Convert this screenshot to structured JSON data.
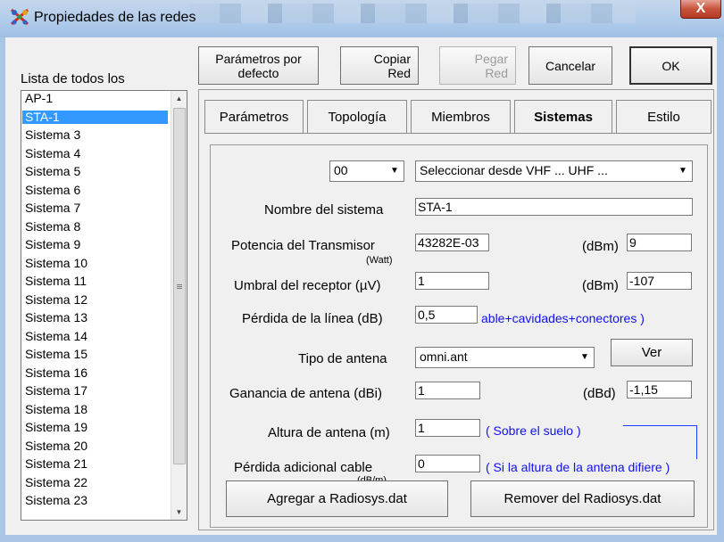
{
  "window": {
    "title": "Propiedades de las redes",
    "close_label": "X"
  },
  "list": {
    "label": "Lista de todos los",
    "items": [
      "AP-1",
      "STA-1",
      "Sistema  3",
      "Sistema  4",
      "Sistema  5",
      "Sistema  6",
      "Sistema  7",
      "Sistema  8",
      "Sistema  9",
      "Sistema  10",
      "Sistema  11",
      "Sistema  12",
      "Sistema  13",
      "Sistema  14",
      "Sistema  15",
      "Sistema  16",
      "Sistema  17",
      "Sistema  18",
      "Sistema  19",
      "Sistema  20",
      "Sistema  21",
      "Sistema  22",
      "Sistema  23"
    ],
    "selected_index": 1
  },
  "toolbar": {
    "defaults_line1": "Parámetros por",
    "defaults_line2": "defecto",
    "copy_line1": "Copiar",
    "copy_line2": "Red",
    "paste_line1": "Pegar",
    "paste_line2": "Red",
    "cancel": "Cancelar",
    "ok": "OK"
  },
  "tabs": [
    "Parámetros",
    "Topología",
    "Miembros",
    "Sistemas",
    "Estilo"
  ],
  "active_tab": "Sistemas",
  "form": {
    "system_number": "00",
    "system_select": "Seleccionar desde VHF ... UHF ...",
    "system_name_label": "Nombre del sistema",
    "system_name": "STA-1",
    "tx_power_label": "Potencia del Transmisor",
    "tx_power_unit_label": "(Watt)",
    "tx_power_watt": "43282E-03",
    "tx_power_dbm_label": "(dBm)",
    "tx_power_dbm": "9",
    "rx_threshold_label": "Umbral del receptor (µV)",
    "rx_threshold_uv": "1",
    "rx_threshold_dbm_label": "(dBm)",
    "rx_threshold_dbm": "-107",
    "line_loss_label": "Pérdida de la línea (dB)",
    "line_loss": "0,5",
    "line_loss_hint": "able+cavidades+conectores )",
    "antenna_type_label": "Tipo de antena",
    "antenna_type": "omni.ant",
    "view_button": "Ver",
    "antenna_gain_label": "Ganancia de antena (dBi)",
    "antenna_gain_dbi": "1",
    "antenna_gain_dbd_label": "(dBd)",
    "antenna_gain_dbd": "-1,15",
    "antenna_height_label": "Altura de antena (m)",
    "antenna_height": "1",
    "antenna_height_hint": "( Sobre el suelo )",
    "extra_loss_label": "Pérdida adicional cable",
    "extra_loss_unit_label": "(dB/m)",
    "extra_loss": "0",
    "extra_loss_hint": "( Si la altura de la antena difiere )"
  },
  "bottom": {
    "add_button": "Agregar a Radiosys.dat",
    "remove_button": "Remover del Radiosys.dat"
  },
  "colors": {
    "selection": "#3399ff",
    "hint_text": "#1111ee",
    "close_button": "#c8523c"
  }
}
